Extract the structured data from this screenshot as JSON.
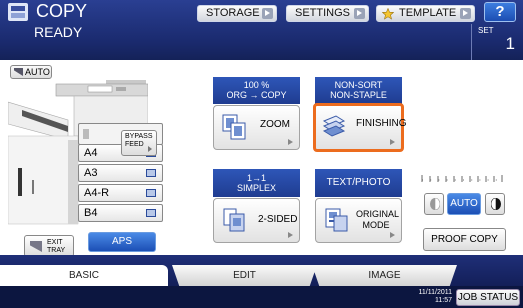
{
  "header": {
    "title": "COPY",
    "status": "READY",
    "storage_label": "STORAGE",
    "settings_label": "SETTINGS",
    "template_label": "TEMPLATE",
    "help_label": "?",
    "set_label": "SET",
    "set_count": "1"
  },
  "left": {
    "auto_label": "AUTO",
    "trays": [
      "A4",
      "A3",
      "A4-R",
      "B4"
    ],
    "bypass_line1": "BYPASS",
    "bypass_line2": "FEED",
    "exit_line1": "EXIT",
    "exit_line2": "TRAY",
    "aps_label": "APS"
  },
  "functions": {
    "zoom_head_line1": "100 %",
    "zoom_head_line2": "ORG → COPY",
    "zoom_label": "ZOOM",
    "finish_head_line1": "NON-SORT",
    "finish_head_line2": "NON-STAPLE",
    "finish_label": "FINISHING",
    "sided_head_line1": "1→1",
    "sided_head_line2": "SIMPLEX",
    "sided_label": "2-SIDED",
    "mode_head": "TEXT/PHOTO",
    "mode_line1": "ORIGINAL",
    "mode_line2": "MODE"
  },
  "density": {
    "auto_label": "AUTO",
    "proof_label": "PROOF COPY"
  },
  "tabs": [
    {
      "label": "BASIC",
      "active": true
    },
    {
      "label": "EDIT",
      "active": false
    },
    {
      "label": "IMAGE",
      "active": false
    }
  ],
  "footer": {
    "date": "11/11/2011",
    "time": "11:57",
    "job_status_label": "JOB STATUS"
  },
  "colors": {
    "header_blue": "#1a2a6e",
    "accent_blue": "#1c4fb5",
    "selected_orange": "#ec6c1e"
  }
}
